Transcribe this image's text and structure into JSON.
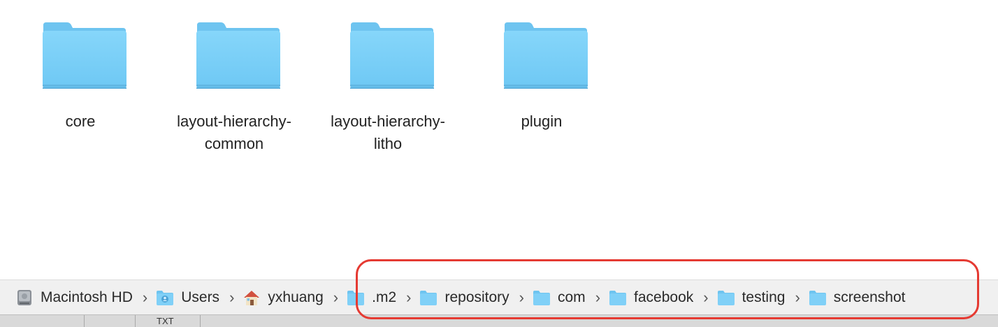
{
  "folders": [
    {
      "label": "core",
      "icon": "folder-icon"
    },
    {
      "label": "layout-hierarchy-common",
      "icon": "folder-icon"
    },
    {
      "label": "layout-hierarchy-litho",
      "icon": "folder-icon"
    },
    {
      "label": "plugin",
      "icon": "folder-icon"
    }
  ],
  "pathbar": {
    "items": [
      {
        "label": "Macintosh HD",
        "icon": "hard-drive-icon"
      },
      {
        "label": "Users",
        "icon": "users-folder-icon"
      },
      {
        "label": "yxhuang",
        "icon": "home-icon"
      },
      {
        "label": ".m2",
        "icon": "folder-icon"
      },
      {
        "label": "repository",
        "icon": "folder-icon"
      },
      {
        "label": "com",
        "icon": "folder-icon"
      },
      {
        "label": "facebook",
        "icon": "folder-icon"
      },
      {
        "label": "testing",
        "icon": "folder-icon"
      },
      {
        "label": "screenshot",
        "icon": "folder-icon"
      }
    ],
    "separator": "›"
  },
  "status_strip": {
    "column_label": "TXT"
  },
  "colors": {
    "folder_body": "#7dd0f7",
    "folder_tab": "#6ec4f0",
    "highlight": "#e53a32",
    "pathbar_bg": "#f0f0f0"
  }
}
